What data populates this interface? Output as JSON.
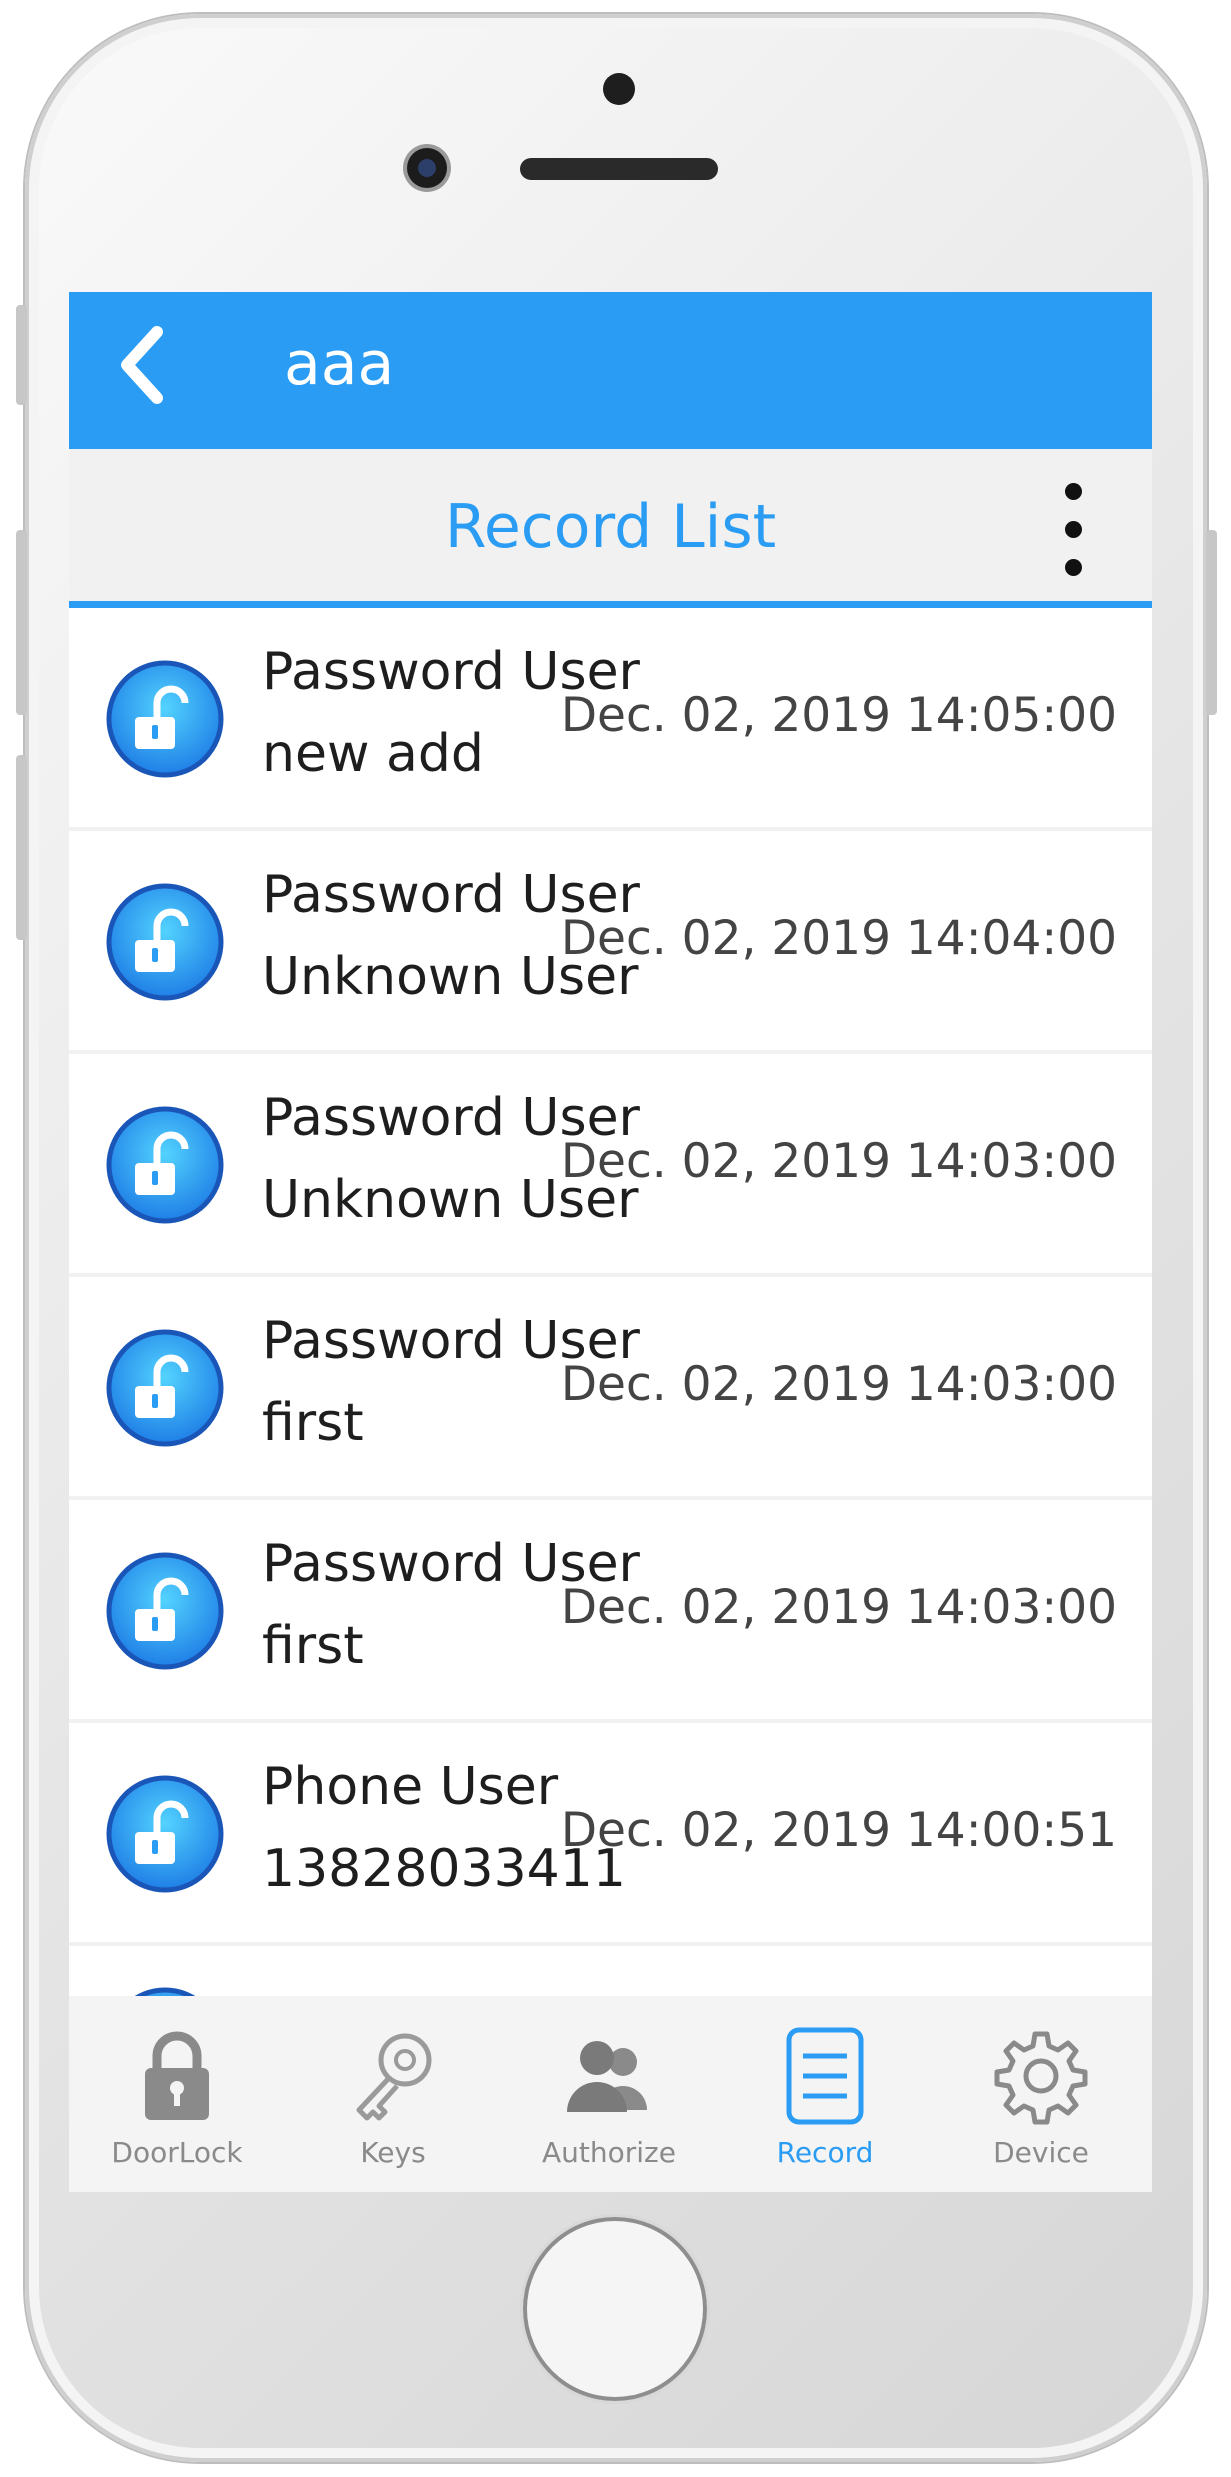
{
  "header": {
    "title": "aaa",
    "back_icon": "chevron-left-icon"
  },
  "subheader": {
    "title": "Record List",
    "menu_icon": "more-vertical-icon"
  },
  "records": [
    {
      "type": "Password User",
      "name": "new add",
      "time": "Dec. 02, 2019 14:05:00",
      "icon": "unlock-icon"
    },
    {
      "type": "Password User",
      "name": "Unknown User",
      "time": "Dec. 02, 2019 14:04:00",
      "icon": "unlock-icon"
    },
    {
      "type": "Password User",
      "name": "Unknown User",
      "time": "Dec. 02, 2019 14:03:00",
      "icon": "unlock-icon"
    },
    {
      "type": "Password User",
      "name": "first",
      "time": "Dec. 02, 2019 14:03:00",
      "icon": "unlock-icon"
    },
    {
      "type": "Password User",
      "name": "first",
      "time": "Dec. 02, 2019 14:03:00",
      "icon": "unlock-icon"
    },
    {
      "type": "Phone User",
      "name": "13828033411",
      "time": "Dec. 02, 2019 14:00:51",
      "icon": "unlock-icon"
    }
  ],
  "tabs": [
    {
      "label": "DoorLock",
      "icon": "padlock-icon"
    },
    {
      "label": "Keys",
      "icon": "key-icon"
    },
    {
      "label": "Authorize",
      "icon": "users-icon"
    },
    {
      "label": "Record",
      "icon": "document-list-icon",
      "active": true
    },
    {
      "label": "Device",
      "icon": "gear-icon"
    }
  ],
  "colors": {
    "accent": "#2a9cf3",
    "background": "#f1f1f1",
    "tab_inactive": "#8a8a8a"
  }
}
